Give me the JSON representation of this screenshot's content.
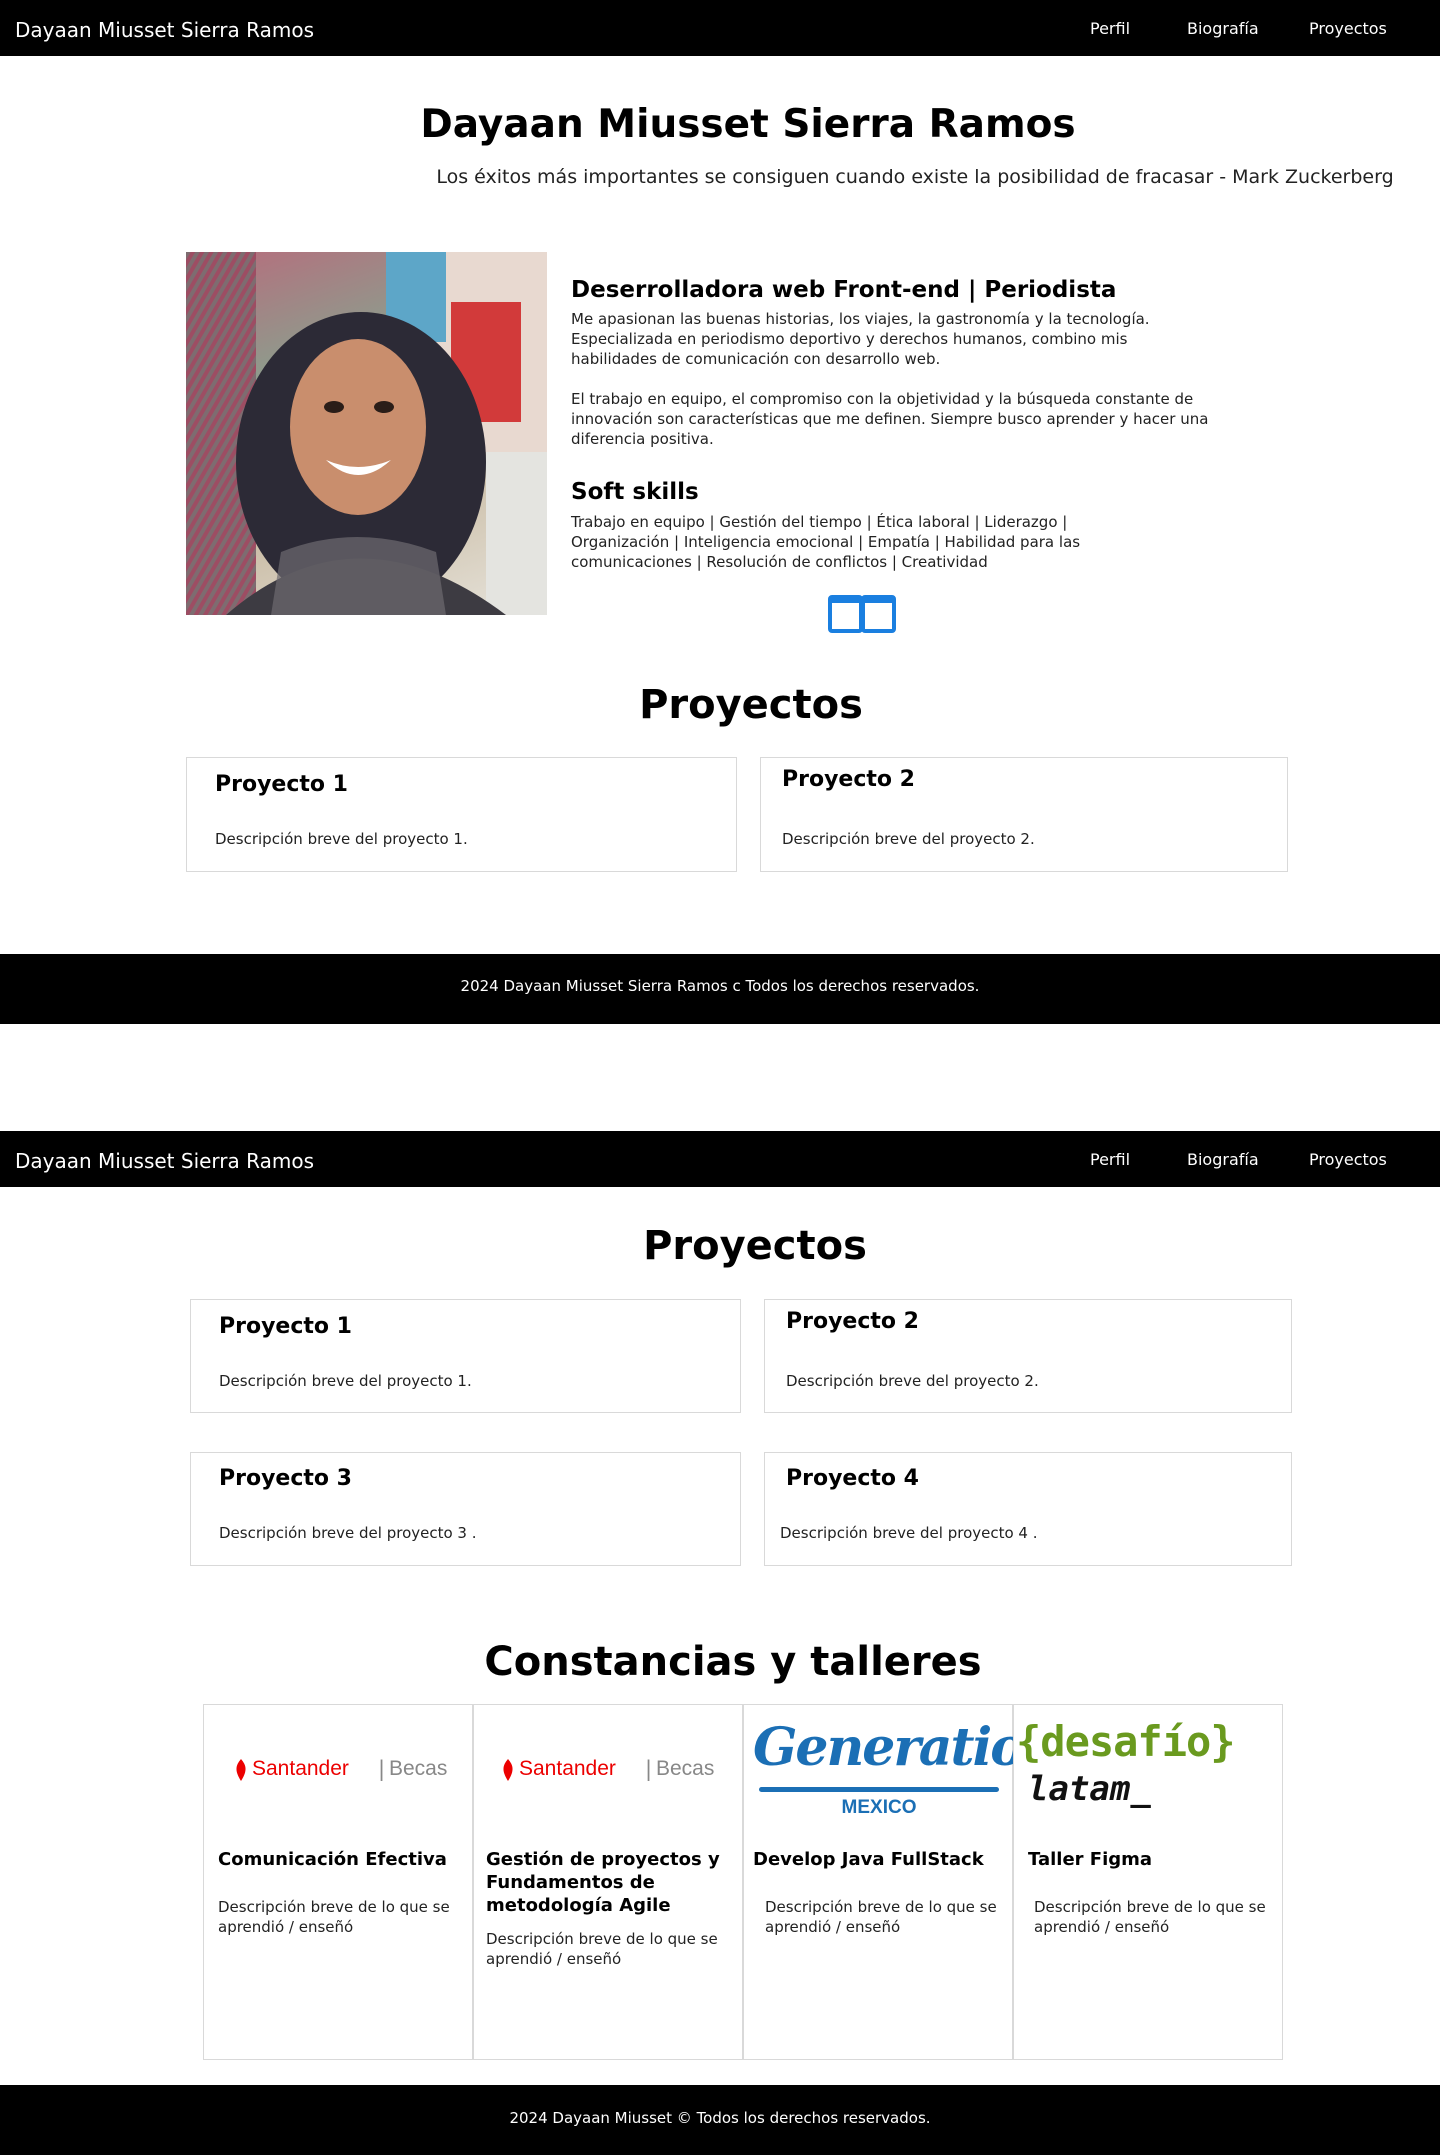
{
  "site": {
    "brand": "Dayaan Miusset Sierra Ramos",
    "nav": [
      "Perfil",
      "Biografía",
      "Proyectos"
    ]
  },
  "hero": {
    "name": "Dayaan Miusset Sierra Ramos",
    "quote": "Los éxitos más importantes se consiguen cuando existe la posibilidad de fracasar - Mark Zuckerberg"
  },
  "profile": {
    "role": "Deserrolladora web Front-end | Periodista",
    "bio1": "Me apasionan las buenas historias, los viajes, la gastronomía y la tecnología. Especializada en periodismo deportivo y derechos humanos, combino mis habilidades de comunicación con desarrollo web.",
    "bio2": "El trabajo en equipo, el compromiso con la objetividad y la búsqueda constante de innovación son características que me definen. Siempre busco aprender y hacer una diferencia positiva.",
    "soft_title": "Soft skills",
    "soft_text": "Trabajo en equipo | Gestión del tiempo | Ética laboral | Liderazgo | Organización | Inteligencia emocional | Empatía | Habilidad para las comunicaciones | Resolución de conflictos | Creatividad",
    "book_icon": "book-open-icon",
    "accent": "#1a7fe0"
  },
  "projects_section1": {
    "title": "Proyectos",
    "items": [
      {
        "title": "Proyecto 1",
        "desc": "Descripción breve del proyecto 1."
      },
      {
        "title": "Proyecto 2",
        "desc": "Descripción breve del proyecto 2."
      }
    ]
  },
  "footer1": "2024 Dayaan Miusset Sierra Ramos c Todos los derechos reservados.",
  "projects_section2": {
    "title": "Proyectos",
    "items": [
      {
        "title": "Proyecto 1",
        "desc": "Descripción breve del proyecto 1."
      },
      {
        "title": "Proyecto 2",
        "desc": "Descripción breve del proyecto 2."
      },
      {
        "title": "Proyecto 3",
        "desc": "Descripción breve del proyecto 3 ."
      },
      {
        "title": "Proyecto 4",
        "desc": "Descripción breve del proyecto 4 ."
      }
    ]
  },
  "constancias": {
    "title": "Constancias y talleres",
    "items": [
      {
        "logo_brand": "Santander",
        "logo_sub": "Becas",
        "title": "Comunicación Efectiva",
        "desc": "Descripción breve de lo que se aprendió / enseñó"
      },
      {
        "logo_brand": "Santander",
        "logo_sub": "Becas",
        "title": "Gestión de proyectos y Fundamentos de metodología Agile",
        "desc": "Descripción breve de lo que se aprendió / enseñó"
      },
      {
        "logo_brand": "Generation",
        "logo_sub": "MEXICO",
        "title": "Develop Java FullStack",
        "desc": "Descripción breve de lo que se aprendió / enseñó"
      },
      {
        "logo_brand": "{desafío}",
        "logo_sub": "latam_",
        "title": "Taller Figma",
        "desc": "Descripción breve de lo que se aprendió / enseñó"
      }
    ]
  },
  "footer2": "2024 Dayaan Miusset © Todos los derechos reservados.",
  "colors": {
    "santander_red": "#ec0000",
    "generation_blue": "#1b6fb5",
    "desafio_green": "#6a9a1f",
    "nav_bg": "#000000"
  }
}
